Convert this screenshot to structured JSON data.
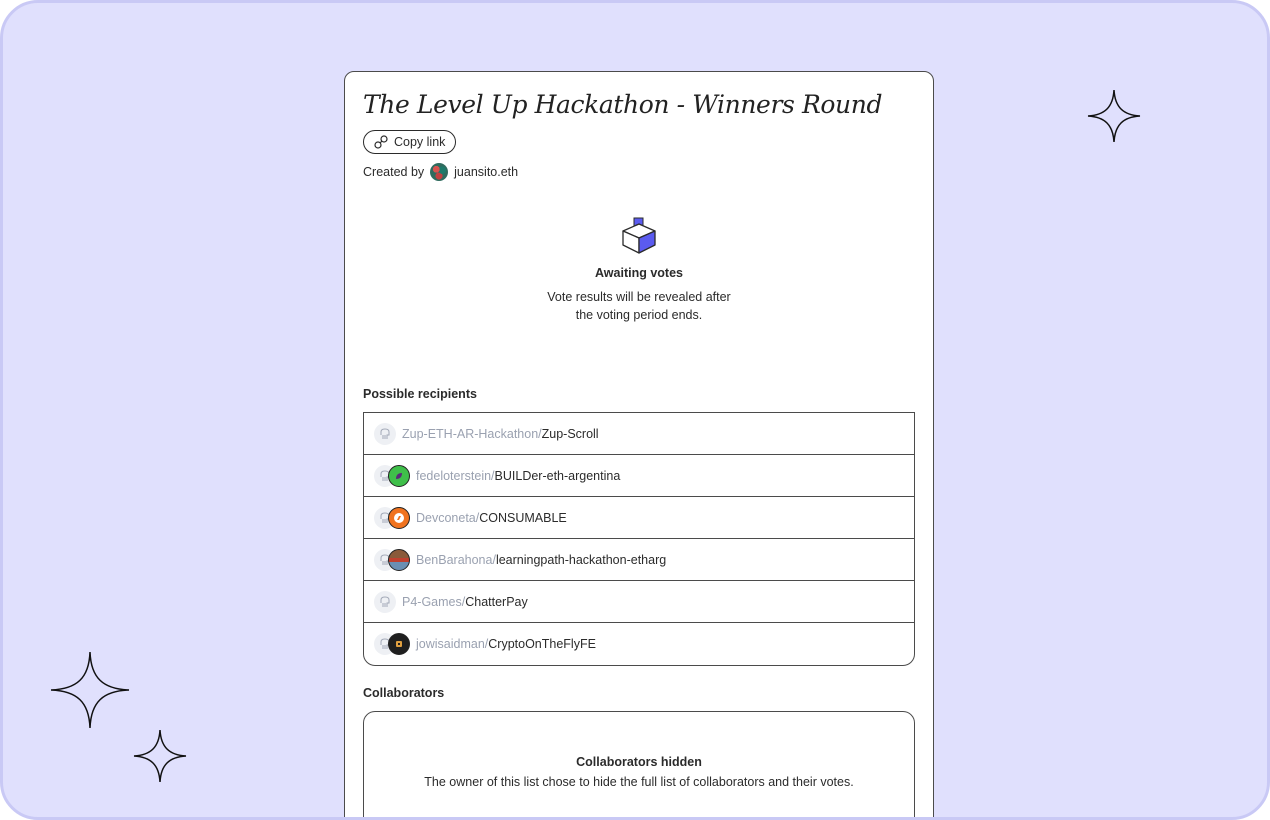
{
  "page": {
    "title": "The Level Up Hackathon - Winners Round",
    "copy_link_label": "Copy link",
    "created_by_label": "Created by",
    "creator": "juansito.eth"
  },
  "awaiting": {
    "title": "Awaiting votes",
    "line1": "Vote results will be revealed after",
    "line2": "the voting period ends."
  },
  "recipients": {
    "label": "Possible recipients",
    "items": [
      {
        "owner": "Zup-ETH-AR-Hackathon/",
        "repo": "Zup-Scroll",
        "avatar": "none",
        "avatar_color": ""
      },
      {
        "owner": "fedeloterstein/",
        "repo": "BUILDer-eth-argentina",
        "avatar": "leaf-avatar",
        "avatar_color": "#3fbf4a"
      },
      {
        "owner": "Devconeta/",
        "repo": "CONSUMABLE",
        "avatar": "compass-avatar",
        "avatar_color": "#f0731f"
      },
      {
        "owner": "BenBarahona/",
        "repo": "learningpath-hackathon-etharg",
        "avatar": "photo-avatar",
        "avatar_color": "#8a5a3a"
      },
      {
        "owner": "P4-Games/",
        "repo": "ChatterPay",
        "avatar": "none",
        "avatar_color": ""
      },
      {
        "owner": "jowisaidman/",
        "repo": "CryptoOnTheFlyFE",
        "avatar": "dark-avatar",
        "avatar_color": "#1f1f1f"
      }
    ]
  },
  "collaborators": {
    "label": "Collaborators",
    "hidden_title": "Collaborators hidden",
    "hidden_text": "The owner of this list chose to hide the full list of collaborators and their votes."
  },
  "colors": {
    "background": "#e0e0fd",
    "ballot_accent": "#5b5bf0"
  }
}
